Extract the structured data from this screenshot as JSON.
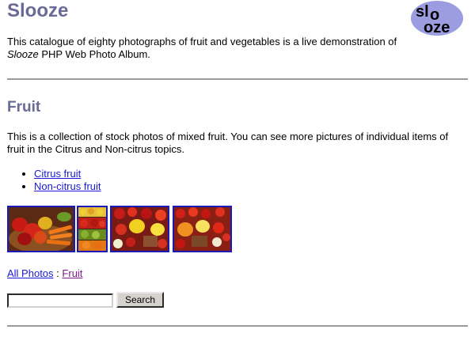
{
  "site": {
    "title": "Slooze",
    "logo_text": "Slooze",
    "intro_before": "This catalogue of eighty photographs of fruit and vegetables is a live demonstration of ",
    "intro_em": "Slooze",
    "intro_after": " PHP Web Photo Album."
  },
  "topic": {
    "title": "Fruit",
    "description": "This is a collection of stock photos of mixed fruit. You can see more pictures of individual items of fruit in the Citrus and Non-citrus topics.",
    "subtopics": [
      {
        "label": "Citrus fruit"
      },
      {
        "label": "Non-citrus fruit"
      }
    ]
  },
  "thumbnails": [
    {
      "name": "thumb-fruit-basket-carrots",
      "subject": "basket of fruit and carrots"
    },
    {
      "name": "thumb-fruit-stall",
      "subject": "fruit stall"
    },
    {
      "name": "thumb-mixed-fruit-1",
      "subject": "mixed fruit and lemons"
    },
    {
      "name": "thumb-mixed-fruit-2",
      "subject": "mixed fruit and strawberries"
    }
  ],
  "breadcrumb": {
    "root": "All Photos",
    "separator": ":",
    "current": "Fruit"
  },
  "search": {
    "value": "",
    "button_label": "Search"
  },
  "colors": {
    "heading": "#6a6a96",
    "link": "#1a1ad0",
    "visited_link": "#7a1a8a",
    "thumb_border": "#1a1ab8",
    "rule": "#9a9a9a",
    "logo_bg": "#9c9ce0"
  }
}
